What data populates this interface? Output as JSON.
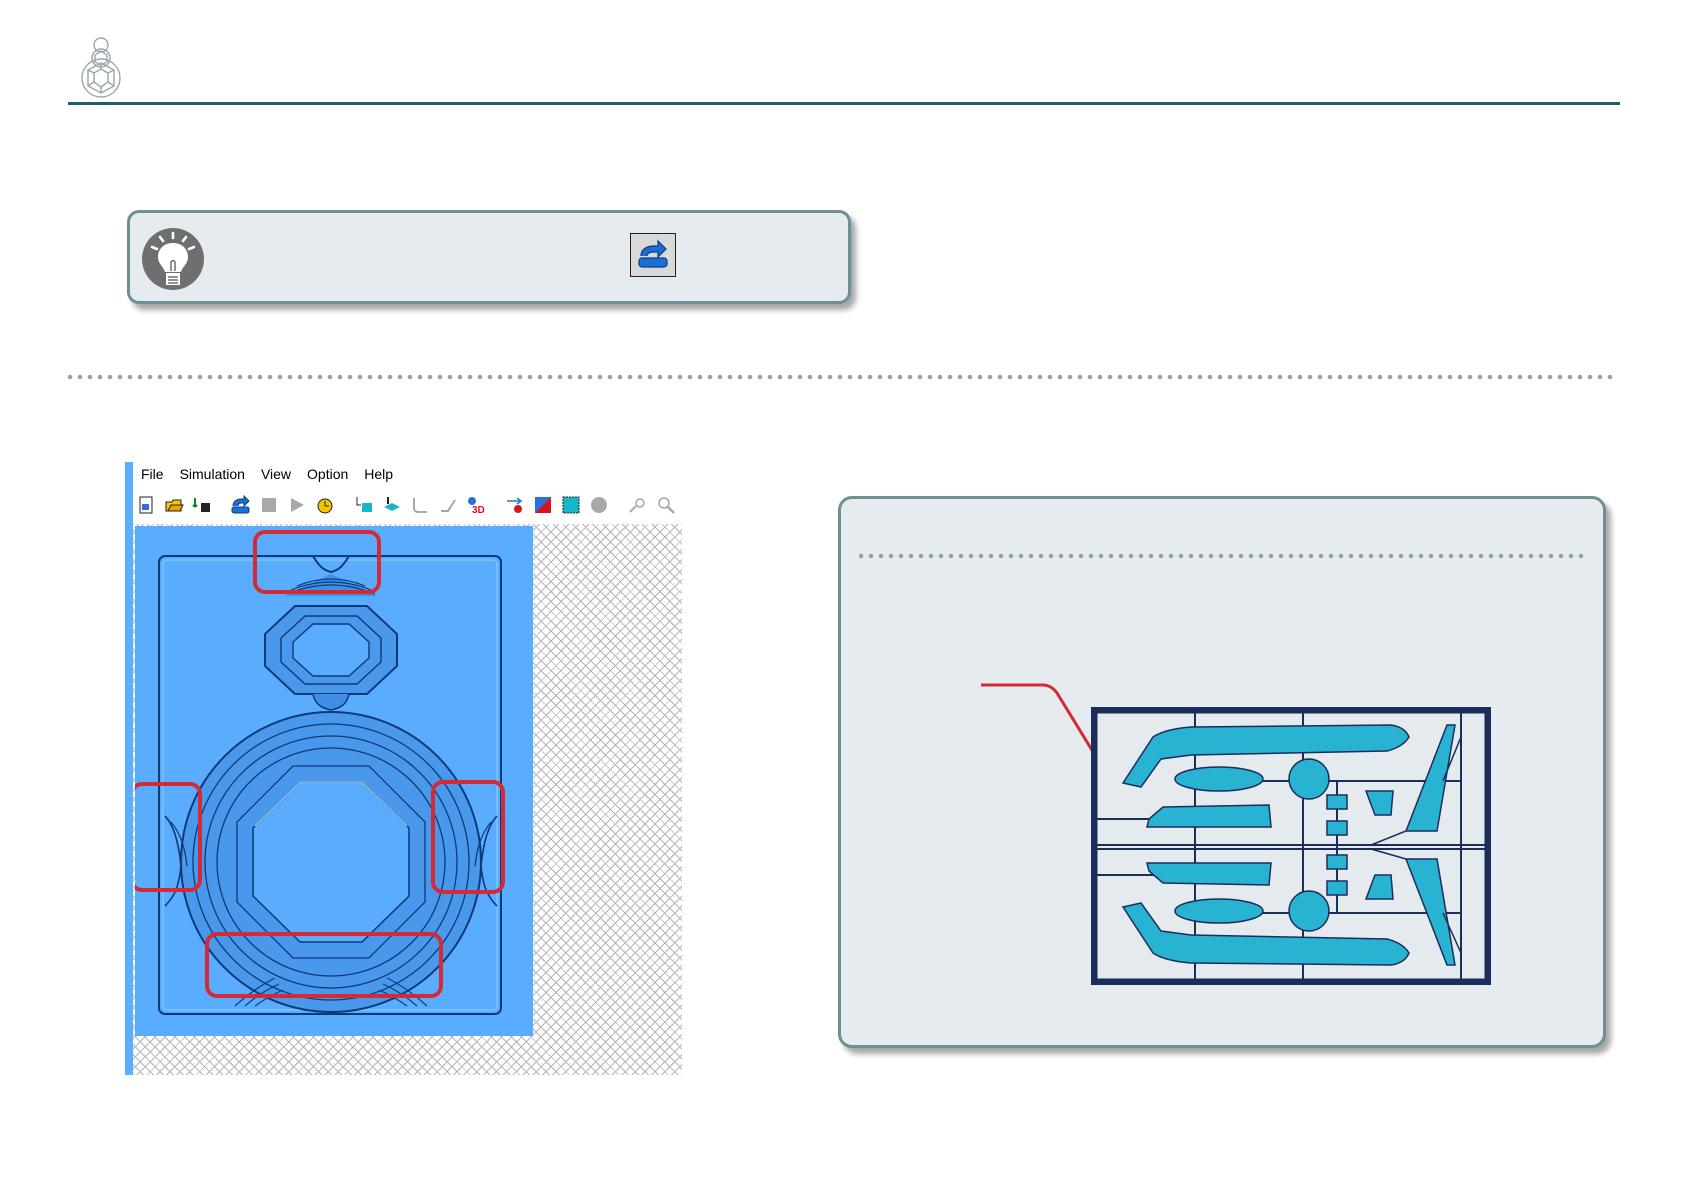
{
  "app": {
    "menu": [
      "File",
      "Simulation",
      "View",
      "Option",
      "Help"
    ],
    "toolbar_icons": [
      "new-file-icon",
      "open-folder-icon",
      "export-icon",
      "redo-simulation-icon",
      "stop-icon",
      "play-icon",
      "timer-icon",
      "surface-view-icon",
      "tool-view-icon",
      "path-view-icon",
      "path-view-2-icon",
      "3d-view-icon",
      "cut-area-icon",
      "color-icon",
      "select-icon",
      "sphere-icon",
      "zoom-move-icon",
      "zoom-icon"
    ]
  },
  "colors": {
    "accent": "#1f5c6e",
    "box_fill": "#e6ebef",
    "box_border": "#6e8f93",
    "highlight": "#d42a36",
    "canvas_blue": "#5aacff",
    "part_blue": "#29b3d3",
    "frame_navy": "#1b2d5a"
  }
}
